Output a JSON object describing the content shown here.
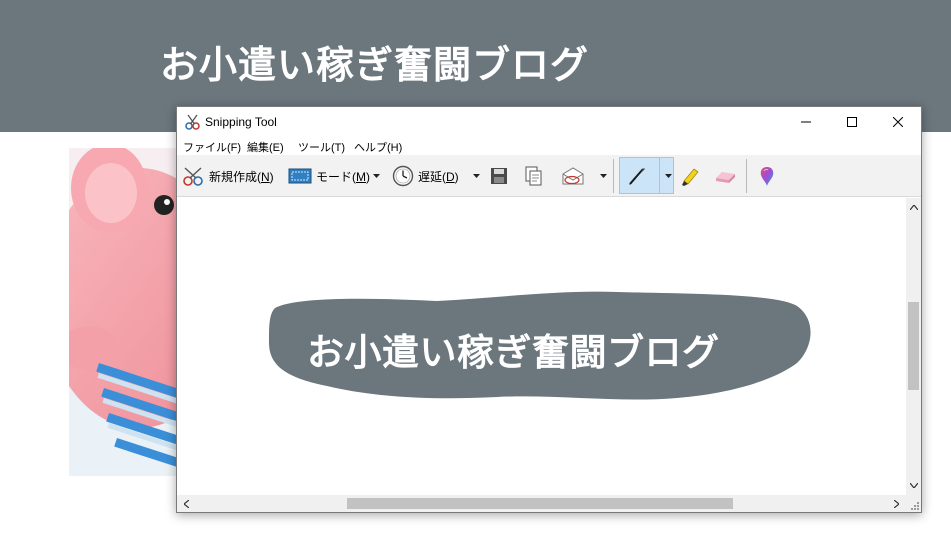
{
  "blog": {
    "title": "お小遣い稼ぎ奮闘ブログ"
  },
  "window": {
    "title": "Snipping Tool",
    "controls": {
      "minimize": "minimize",
      "maximize": "maximize",
      "close": "close"
    }
  },
  "menu": [
    {
      "label": "ファイル(F)"
    },
    {
      "label": "編集(E)"
    },
    {
      "label": "ツール(T)"
    },
    {
      "label": "ヘルプ(H)"
    }
  ],
  "toolbar": {
    "new_label": "新規作成(",
    "new_key": "N",
    "mode_label": "モード(",
    "mode_key": "M",
    "delay_label": "遅延(",
    "delay_key": "D",
    "close_paren": ")"
  },
  "icons": {
    "new": "scissors-icon",
    "mode": "rectangle-mode-icon",
    "delay": "clock-icon",
    "save": "save-icon",
    "copy": "copy-icon",
    "send": "envelope-icon",
    "pen": "pen-icon",
    "highlighter": "highlighter-icon",
    "eraser": "eraser-icon",
    "paint3d": "paint3d-icon"
  },
  "snip": {
    "text": "お小遣い稼ぎ奮闘ブログ"
  },
  "colors": {
    "banner": "#6b767d",
    "snip_background": "#6b767d",
    "pen_selected": "#cce4f7"
  }
}
